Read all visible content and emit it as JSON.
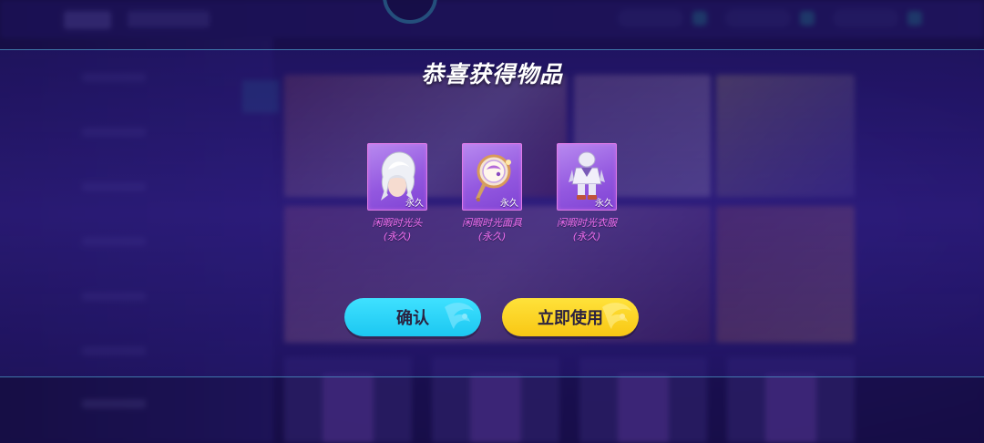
{
  "dialog": {
    "title": "恭喜获得物品",
    "items": [
      {
        "icon": "silver-hair-head-icon",
        "duration_badge": "永久",
        "name": "闲暇时光头",
        "duration": "(永久)"
      },
      {
        "icon": "ornate-mask-icon",
        "duration_badge": "永久",
        "name": "闲暇时光面具",
        "duration": "(永久)"
      },
      {
        "icon": "outfit-costume-icon",
        "duration_badge": "永久",
        "name": "闲暇时光衣服",
        "duration": "(永久)"
      }
    ],
    "buttons": {
      "confirm": "确认",
      "use_now": "立即使用"
    }
  },
  "colors": {
    "item_name": "#ef6ef0",
    "confirm_button": "#1cc7f1",
    "use_button": "#f8c714",
    "frame_border": "#e07ae8",
    "frame_fill": "#9459e0"
  }
}
